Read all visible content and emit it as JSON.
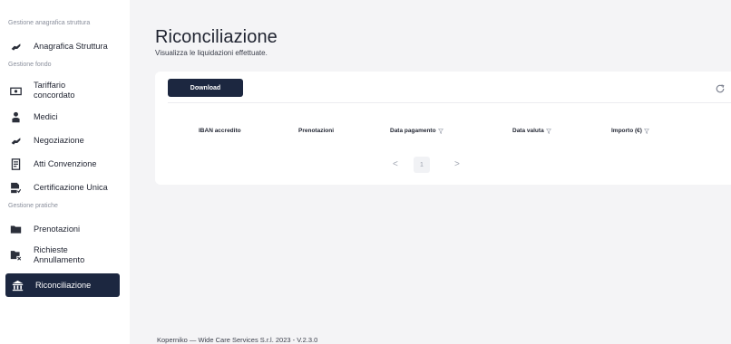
{
  "sidebar": {
    "sections": [
      {
        "title": "Gestione anagrafica struttura",
        "items": [
          {
            "label": "Anagrafica Struttura",
            "icon": "handshake-icon"
          }
        ]
      },
      {
        "title": "Gestione fondo",
        "items": [
          {
            "label": "Tariffario concordato",
            "icon": "money-icon"
          },
          {
            "label": "Medici",
            "icon": "doctor-icon"
          },
          {
            "label": "Negoziazione",
            "icon": "handshake-icon"
          },
          {
            "label": "Atti Convenzione",
            "icon": "document-icon"
          },
          {
            "label": "Certificazione Unica",
            "icon": "certificate-icon"
          }
        ]
      },
      {
        "title": "Gestione pratiche",
        "items": [
          {
            "label": "Prenotazioni",
            "icon": "folder-icon"
          },
          {
            "label": "Richieste Annullamento",
            "icon": "folder-x-icon"
          },
          {
            "label": "Riconciliazione",
            "icon": "bank-icon",
            "active": true
          }
        ]
      }
    ]
  },
  "page": {
    "title": "Riconciliazione",
    "subtitle": "Visualizza le liquidazioni effettuate."
  },
  "toolbar": {
    "download_label": "Download",
    "refresh_icon": "refresh-icon"
  },
  "table": {
    "columns": [
      {
        "label": "IBAN accredito",
        "filter": false
      },
      {
        "label": "Prenotazioni",
        "filter": false
      },
      {
        "label": "Data pagamento",
        "filter": true
      },
      {
        "label": "Data valuta",
        "filter": true
      },
      {
        "label": "Importo (€)",
        "filter": true
      }
    ],
    "rows": []
  },
  "pagination": {
    "prev": "<",
    "next": ">",
    "current": "1"
  },
  "footer": {
    "text": "Koperniko — Wide Care Services S.r.l. 2023 - V.2.3.0"
  },
  "colors": {
    "accent": "#1c2740",
    "background": "#f4f4f6",
    "card": "#ffffff"
  }
}
